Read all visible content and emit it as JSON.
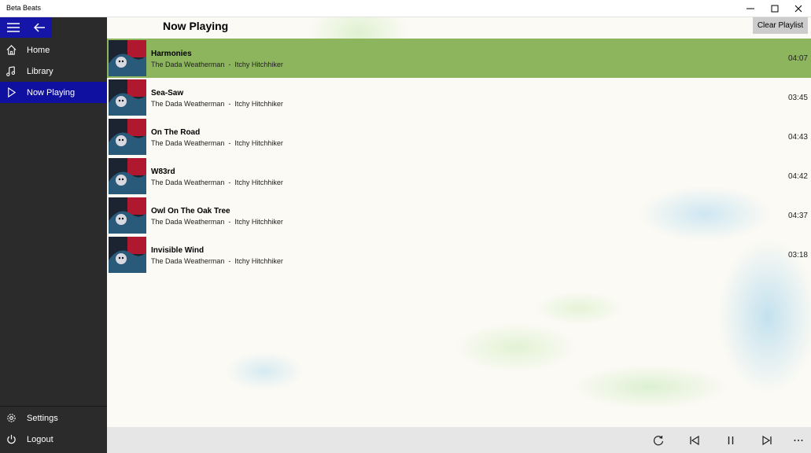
{
  "window": {
    "title": "Beta Beats"
  },
  "nav": {
    "items": [
      {
        "label": "Home",
        "icon": "home-icon"
      },
      {
        "label": "Library",
        "icon": "music-note-icon"
      },
      {
        "label": "Now Playing",
        "icon": "play-icon"
      }
    ],
    "bottom": [
      {
        "label": "Settings",
        "icon": "gear-icon"
      },
      {
        "label": "Logout",
        "icon": "power-icon"
      }
    ]
  },
  "main": {
    "title": "Now Playing",
    "clear_label": "Clear Playlist"
  },
  "tracks": [
    {
      "title": "Harmonies",
      "artist": "The Dada Weatherman",
      "album": "Itchy Hitchhiker",
      "duration": "04:07",
      "active": true
    },
    {
      "title": "Sea-Saw",
      "artist": "The Dada Weatherman",
      "album": "Itchy Hitchhiker",
      "duration": "03:45"
    },
    {
      "title": "On The Road",
      "artist": "The Dada Weatherman",
      "album": "Itchy Hitchhiker",
      "duration": "04:43"
    },
    {
      "title": "W83rd",
      "artist": "The Dada Weatherman",
      "album": "Itchy Hitchhiker",
      "duration": "04:42"
    },
    {
      "title": "Owl On The Oak Tree",
      "artist": "The Dada Weatherman",
      "album": "Itchy Hitchhiker",
      "duration": "04:37"
    },
    {
      "title": "Invisible Wind",
      "artist": "The Dada Weatherman",
      "album": "Itchy Hitchhiker",
      "duration": "03:18"
    }
  ],
  "colors": {
    "accent": "#1010a0",
    "active_row": "#8db55e",
    "sidebar": "#2b2b2b"
  }
}
